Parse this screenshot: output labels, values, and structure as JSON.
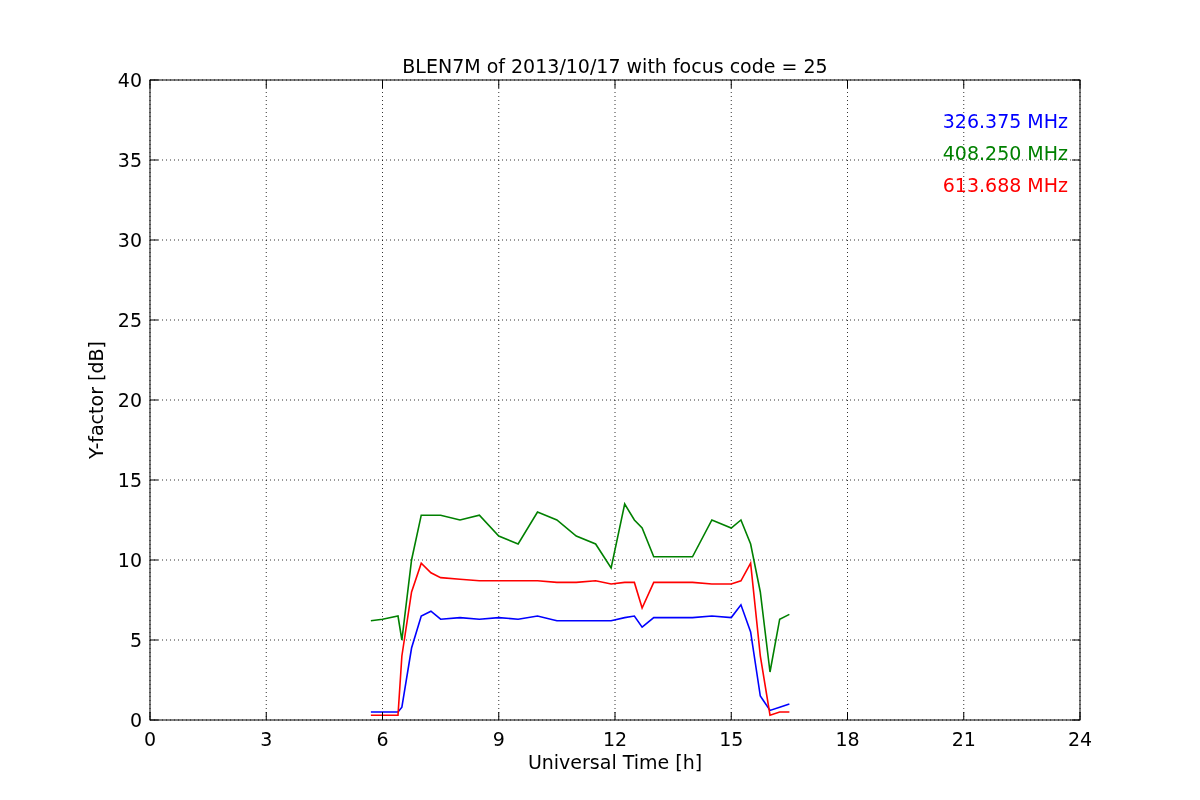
{
  "chart_data": {
    "type": "line",
    "title": "BLEN7M of 2013/10/17 with focus code = 25",
    "xlabel": "Universal Time [h]",
    "ylabel": "Y-factor [dB]",
    "x": [
      5.7,
      6.0,
      6.4,
      6.5,
      6.75,
      7.0,
      7.25,
      7.5,
      8,
      8.5,
      9,
      9.5,
      10,
      10.5,
      11,
      11.5,
      11.9,
      12.25,
      12.5,
      12.7,
      13,
      13.5,
      14,
      14.5,
      15,
      15.25,
      15.5,
      15.75,
      16,
      16.25,
      16.5
    ],
    "series": [
      {
        "name": "326.375 MHz",
        "color": "#0000ff",
        "values": [
          0.5,
          0.5,
          0.5,
          0.8,
          4.5,
          6.5,
          6.8,
          6.3,
          6.4,
          6.3,
          6.4,
          6.3,
          6.5,
          6.2,
          6.2,
          6.2,
          6.2,
          6.4,
          6.5,
          5.8,
          6.4,
          6.4,
          6.4,
          6.5,
          6.4,
          7.2,
          5.5,
          1.5,
          0.6,
          0.8,
          1.0
        ]
      },
      {
        "name": "408.250 MHz",
        "color": "#008000",
        "values": [
          6.2,
          6.3,
          6.5,
          5.0,
          10,
          12.8,
          12.8,
          12.8,
          12.5,
          12.8,
          11.5,
          11,
          13,
          12.5,
          11.5,
          11,
          9.5,
          13.5,
          12.5,
          12,
          10.2,
          10.2,
          10.2,
          12.5,
          12,
          12.5,
          11,
          8,
          3,
          6.3,
          6.6
        ]
      },
      {
        "name": "613.688 MHz",
        "color": "#ff0000",
        "values": [
          0.3,
          0.3,
          0.3,
          4,
          8,
          9.8,
          9.2,
          8.9,
          8.8,
          8.7,
          8.7,
          8.7,
          8.7,
          8.6,
          8.6,
          8.7,
          8.5,
          8.6,
          8.6,
          7,
          8.6,
          8.6,
          8.6,
          8.5,
          8.5,
          8.7,
          9.8,
          4,
          0.3,
          0.5,
          0.5
        ]
      }
    ],
    "xlim": [
      0,
      24
    ],
    "ylim": [
      0,
      40
    ],
    "xticks": [
      0,
      3,
      6,
      9,
      12,
      15,
      18,
      21,
      24
    ],
    "yticks": [
      0,
      5,
      10,
      15,
      20,
      25,
      30,
      35,
      40
    ],
    "grid": true
  }
}
